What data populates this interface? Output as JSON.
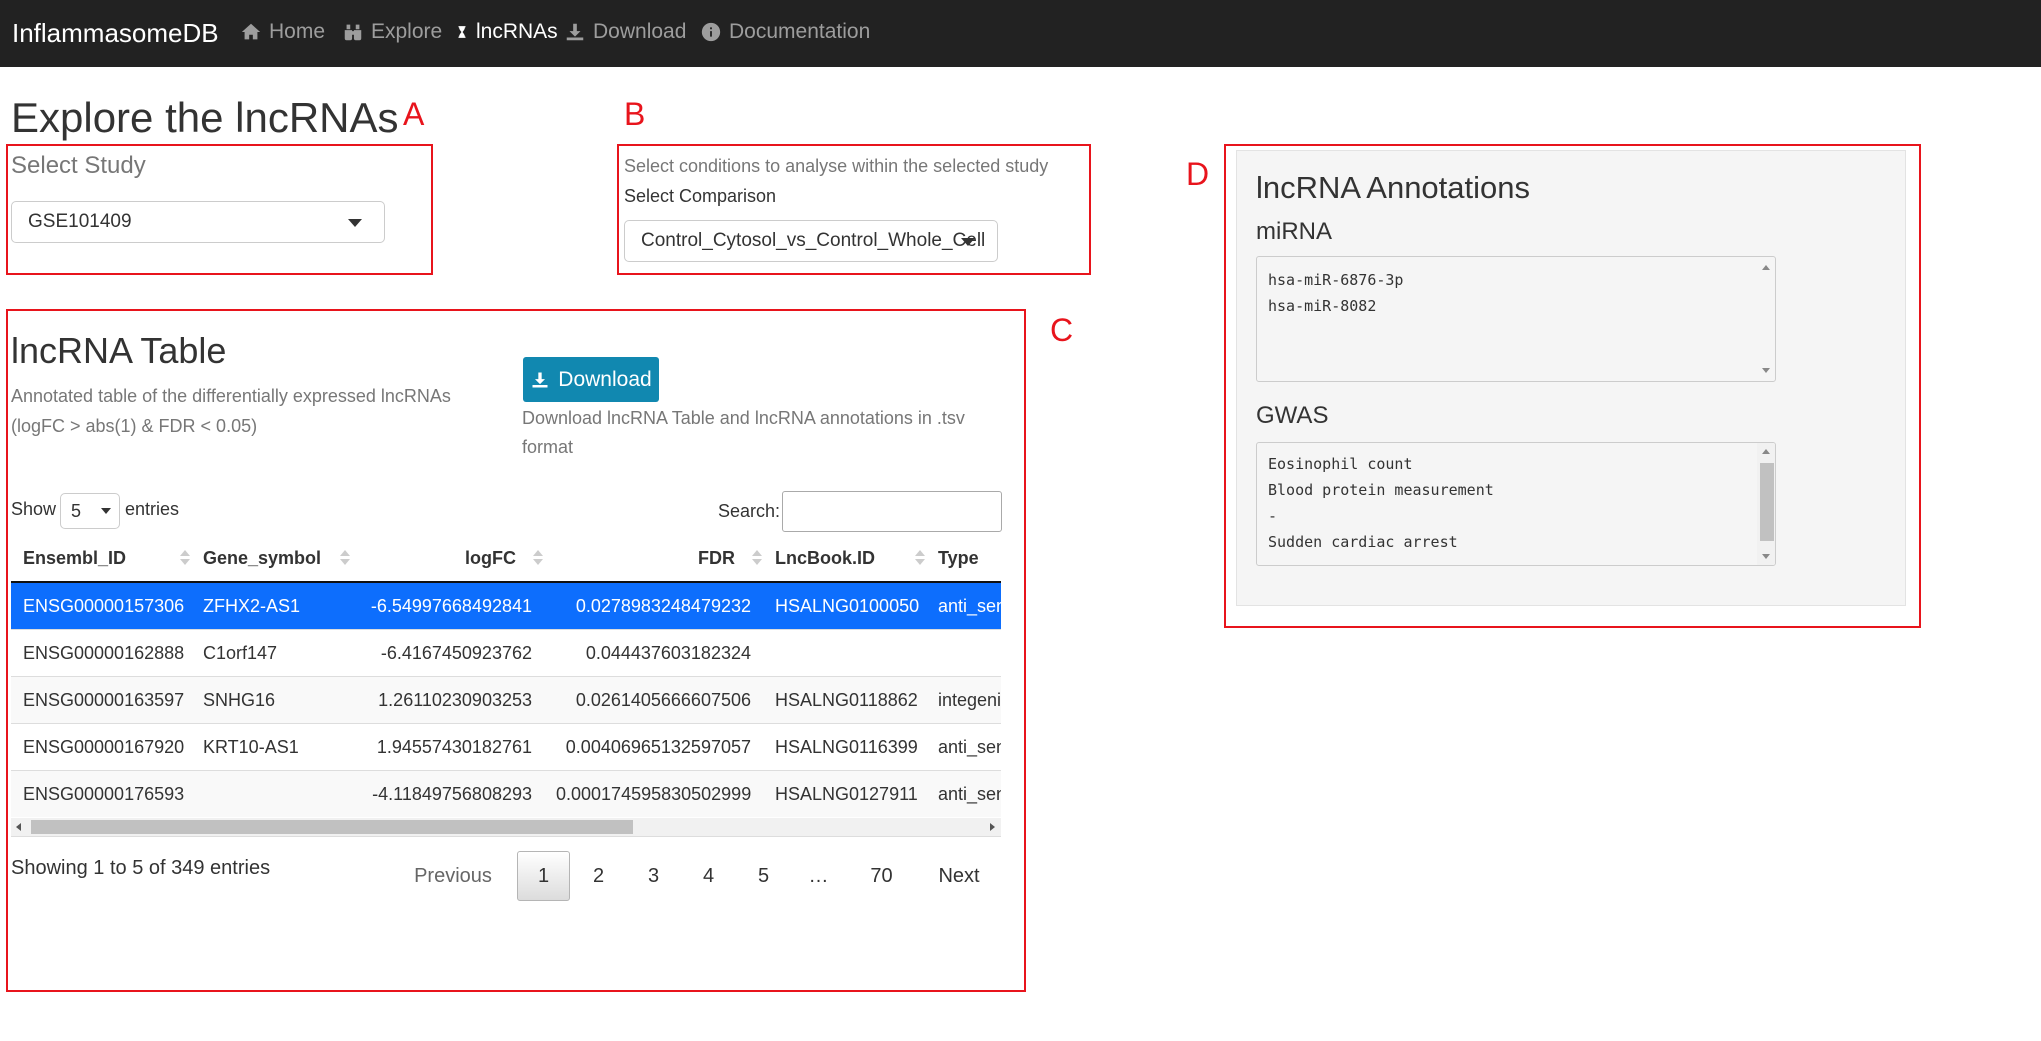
{
  "navbar": {
    "brand": "InflammasomeDB",
    "items": [
      {
        "label": "Home",
        "icon": "home-icon",
        "active": false
      },
      {
        "label": "Explore",
        "icon": "binoculars-icon",
        "active": false
      },
      {
        "label": "lncRNAs",
        "icon": "hourglass-icon",
        "active": true
      },
      {
        "label": "Download",
        "icon": "download-icon",
        "active": false
      },
      {
        "label": "Documentation",
        "icon": "info-circle-icon",
        "active": false
      }
    ]
  },
  "page": {
    "title": "Explore the lncRNAs"
  },
  "annotations": {
    "a": "A",
    "b": "B",
    "c": "C",
    "d": "D"
  },
  "study": {
    "label": "Select Study",
    "value": "GSE101409"
  },
  "comparison": {
    "help": "Select conditions to analyse within the selected study",
    "label": "Select Comparison",
    "value": "Control_Cytosol_vs_Control_Whole_Cell"
  },
  "table_section": {
    "title": "lncRNA Table",
    "desc_line1": "Annotated table of the differentially expressed lncRNAs",
    "desc_line2": "(logFC > abs(1) & FDR < 0.05)",
    "download_label": "Download",
    "download_help_line1": "Download lncRNA Table and lncRNA annotations in .tsv",
    "download_help_line2": "format",
    "show_label": "Show",
    "entries_label": "entries",
    "length_value": "5",
    "search_label": "Search:",
    "search_value": "",
    "columns": [
      "Ensembl_ID",
      "Gene_symbol",
      "logFC",
      "FDR",
      "LncBook.ID",
      "Type"
    ],
    "rows": [
      [
        "ENSG00000157306",
        "ZFHX2-AS1",
        "-6.54997668492841",
        "0.0278983248479232",
        "HSALNG0100050",
        "anti_sense"
      ],
      [
        "ENSG00000162888",
        "C1orf147",
        "-6.4167450923762",
        "0.044437603182324",
        "",
        ""
      ],
      [
        "ENSG00000163597",
        "SNHG16",
        "1.26110230903253",
        "0.0261405666607506",
        "HSALNG0118862",
        "integenic"
      ],
      [
        "ENSG00000167920",
        "KRT10-AS1",
        "1.94557430182761",
        "0.00406965132597057",
        "HSALNG0116399",
        "anti_sense"
      ],
      [
        "ENSG00000176593",
        "",
        "-4.11849756808293",
        "0.000174595830502999",
        "HSALNG0127911",
        "anti_sense"
      ]
    ],
    "selected_row": 0,
    "info": "Showing 1 to 5 of 349 entries",
    "pagination": {
      "previous": "Previous",
      "pages": [
        "1",
        "2",
        "3",
        "4",
        "5",
        "…",
        "70"
      ],
      "next": "Next",
      "current": "1"
    }
  },
  "lnc_annotations": {
    "title": "lncRNA Annotations",
    "mirna_label": "miRNA",
    "mirna": [
      "hsa-miR-6876-3p",
      "hsa-miR-8082"
    ],
    "gwas_label": "GWAS",
    "gwas": [
      "Eosinophil count",
      "Blood protein measurement",
      "-",
      "Sudden cardiac arrest"
    ]
  },
  "colors": {
    "navbar": "#222222",
    "highlight": "#e8141c",
    "selected_row": "#0d6efd",
    "download_button": "#1188b0"
  }
}
